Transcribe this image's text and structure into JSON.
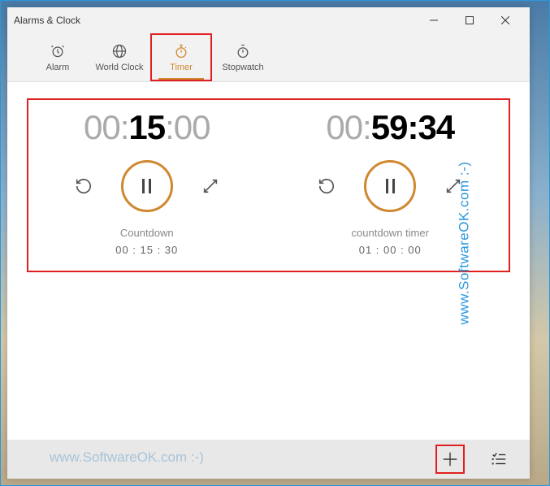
{
  "window": {
    "title": "Alarms & Clock"
  },
  "tabs": [
    {
      "label": "Alarm",
      "icon": "alarm-icon",
      "active": false
    },
    {
      "label": "World Clock",
      "icon": "world-clock-icon",
      "active": false
    },
    {
      "label": "Timer",
      "icon": "timer-icon",
      "active": true
    },
    {
      "label": "Stopwatch",
      "icon": "stopwatch-icon",
      "active": false
    }
  ],
  "timers": [
    {
      "time_dim_prefix": "00:",
      "time_bold": "15",
      "time_dim_suffix": ":00",
      "name": "Countdown",
      "sub": "00 : 15 : 30"
    },
    {
      "time_dim_prefix": "00:",
      "time_bold": "59:34",
      "time_dim_suffix": "",
      "name": "countdown timer",
      "sub": "01 : 00 : 00"
    }
  ],
  "watermark": {
    "bottom": "www.SoftwareOK.com :-)",
    "right": "www.SoftwareOK.com :-)"
  }
}
